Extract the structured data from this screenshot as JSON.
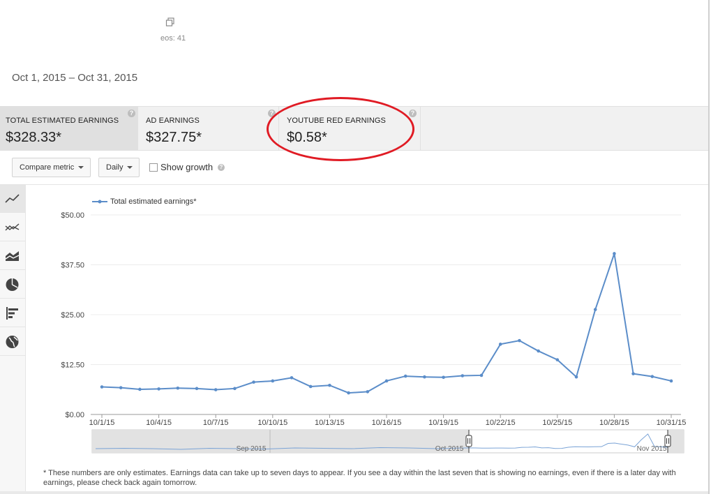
{
  "header": {
    "videos_fragment": "eos: 41",
    "date_range": "Oct 1, 2015 – Oct 31, 2015"
  },
  "metrics": [
    {
      "label": "TOTAL ESTIMATED EARNINGS",
      "value": "$328.33*",
      "active": true
    },
    {
      "label": "AD EARNINGS",
      "value": "$327.75*",
      "active": false
    },
    {
      "label": "YOUTUBE RED EARNINGS",
      "value": "$0.58*",
      "active": false
    }
  ],
  "toolbar": {
    "compare_metric_label": "Compare metric",
    "interval_label": "Daily",
    "show_growth_label": "Show growth",
    "show_growth_checked": false
  },
  "side_rail": {
    "items": [
      {
        "icon": "line-chart-icon",
        "active": true
      },
      {
        "icon": "multiline-chart-icon",
        "active": false
      },
      {
        "icon": "stacked-area-chart-icon",
        "active": false
      },
      {
        "icon": "pie-chart-icon",
        "active": false
      },
      {
        "icon": "bar-chart-icon",
        "active": false
      },
      {
        "icon": "globe-map-icon",
        "active": false
      }
    ]
  },
  "chart_data": {
    "type": "line",
    "series": [
      {
        "name": "Total estimated earnings*",
        "color": "#5b8dc9",
        "values": [
          6.9,
          6.7,
          6.3,
          6.4,
          6.6,
          6.5,
          6.2,
          6.5,
          8.1,
          8.4,
          9.2,
          7.0,
          7.3,
          5.4,
          5.7,
          8.4,
          9.6,
          9.4,
          9.3,
          9.7,
          9.8,
          17.6,
          18.5,
          15.9,
          13.7,
          9.4,
          26.3,
          40.3,
          10.2,
          9.5,
          8.4
        ]
      }
    ],
    "x_tick_labels": [
      "10/1/15",
      "10/4/15",
      "10/7/15",
      "10/10/15",
      "10/13/15",
      "10/16/15",
      "10/19/15",
      "10/22/15",
      "10/25/15",
      "10/28/15",
      "10/31/15"
    ],
    "y_tick_labels": [
      "$0.00",
      "$12.50",
      "$25.00",
      "$37.50",
      "$50.00"
    ],
    "ylim": [
      0,
      50
    ],
    "legend_placement": "top-left",
    "navigator_labels": [
      "Sep 2015",
      "Oct 2015",
      "Nov 2015"
    ]
  },
  "footnote": "* These numbers are only estimates. Earnings data can take up to seven days to appear. If you see a day within the last seven that is showing no earnings, even if there is a later day with earnings, please check back again tomorrow."
}
